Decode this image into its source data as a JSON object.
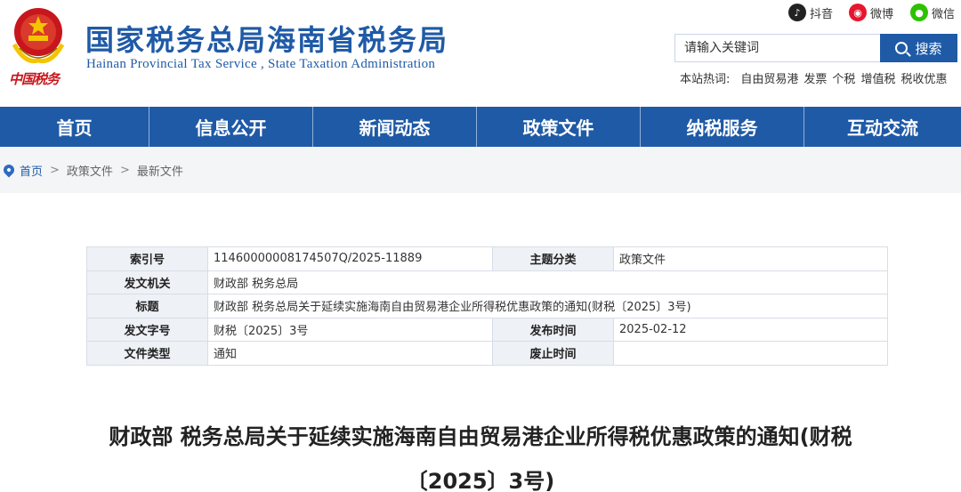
{
  "header": {
    "title": "国家税务总局海南省税务局",
    "subtitle": "Hainan Provincial Tax Service , State Taxation Administration",
    "emblem_caption": "中国税务",
    "social": [
      {
        "icon": "douyin-icon",
        "label": "抖音",
        "color": "#333333"
      },
      {
        "icon": "weibo-icon",
        "label": "微博",
        "color": "#e6162d"
      },
      {
        "icon": "wechat-icon",
        "label": "微信",
        "color": "#2dc100"
      }
    ],
    "search": {
      "placeholder": "请输入关键词",
      "button_label": "搜索"
    },
    "hot": {
      "label": "本站热词:",
      "items": [
        "自由贸易港",
        "发票",
        "个税",
        "增值税",
        "税收优惠"
      ]
    }
  },
  "nav": {
    "items": [
      "首页",
      "信息公开",
      "新闻动态",
      "政策文件",
      "纳税服务",
      "互动交流"
    ]
  },
  "breadcrumb": {
    "items": [
      "首页",
      "政策文件",
      "最新文件"
    ],
    "separator": ">"
  },
  "info": {
    "index_label": "索引号",
    "index_value": "11460000008174507Q/2025-11889",
    "topic_label": "主题分类",
    "topic_value": "政策文件",
    "issuer_label": "发文机关",
    "issuer_value": "财政部 税务总局",
    "title_label": "标题",
    "title_value": "财政部 税务总局关于延续实施海南自由贸易港企业所得税优惠政策的通知(财税〔2025〕3号)",
    "docno_label": "发文字号",
    "docno_value": "财税〔2025〕3号",
    "pubdate_label": "发布时间",
    "pubdate_value": "2025-02-12",
    "type_label": "文件类型",
    "type_value": "通知",
    "expire_label": "废止时间",
    "expire_value": ""
  },
  "article": {
    "title_line1": "财政部 税务总局关于延续实施海南自由贸易港企业所得税优惠政策的通知(财税",
    "title_line2": "〔2025〕3号)"
  },
  "colors": {
    "brand": "#1f5aa6",
    "emblem_red": "#c8161d",
    "nav_divider": "#8fb0db"
  }
}
